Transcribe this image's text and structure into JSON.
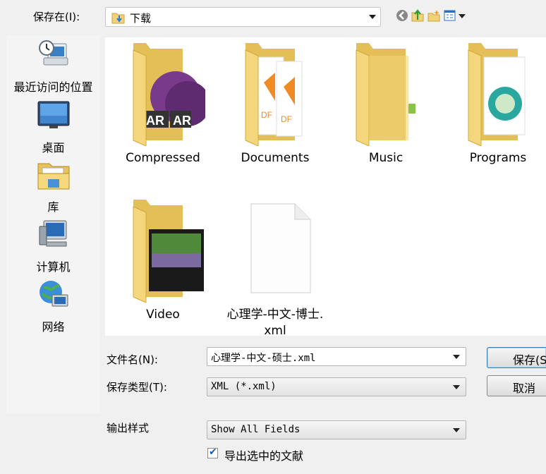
{
  "toolbar": {
    "save_in_label": "保存在(I):",
    "location": "下载",
    "icons": [
      "back-icon",
      "up-folder-icon",
      "new-folder-icon",
      "view-menu-icon"
    ]
  },
  "places": [
    {
      "label": "最近访问的位置",
      "icon": "recent-places-icon"
    },
    {
      "label": "桌面",
      "icon": "desktop-icon"
    },
    {
      "label": "库",
      "icon": "libraries-icon"
    },
    {
      "label": "计算机",
      "icon": "computer-icon"
    },
    {
      "label": "网络",
      "icon": "network-icon"
    }
  ],
  "files": [
    {
      "name": "Compressed",
      "type": "folder"
    },
    {
      "name": "Documents",
      "type": "folder"
    },
    {
      "name": "Music",
      "type": "folder"
    },
    {
      "name": "Programs",
      "type": "folder"
    },
    {
      "name": "Video",
      "type": "folder"
    },
    {
      "name_line1": "心理学-中文-博士.",
      "name_line2": "xml",
      "type": "file"
    }
  ],
  "form": {
    "filename_label": "文件名(N):",
    "filename_value": "心理学-中文-硕士.xml",
    "filetype_label": "保存类型(T):",
    "filetype_value": "XML (*.xml)",
    "output_style_label": "输出样式",
    "output_style_value": "Show All Fields",
    "export_selected_label": "导出选中的文献",
    "export_selected_checked": true,
    "save_button": "保存(S",
    "cancel_button": "取消"
  }
}
